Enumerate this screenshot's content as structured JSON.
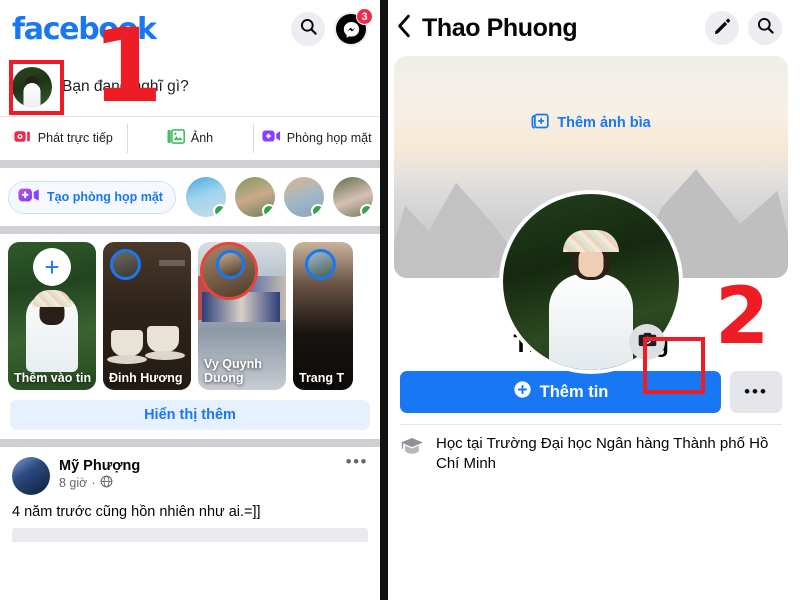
{
  "left_panel": {
    "brand": "facebook",
    "topbar": {
      "search_icon": "search-icon",
      "messenger_icon": "messenger-icon",
      "messenger_badge": "3"
    },
    "composer": {
      "placeholder": "Bạn đang nghĩ gì?",
      "avatar": "user-avatar"
    },
    "actions": [
      {
        "label": "Phát trực tiếp",
        "icon": "live-video-icon",
        "color": "#F02849"
      },
      {
        "label": "Ảnh",
        "icon": "photo-icon",
        "color": "#45BD62"
      },
      {
        "label": "Phòng họp mặt",
        "icon": "video-room-icon",
        "color": "#8A3FFC"
      }
    ],
    "rooms": {
      "create_room_label": "Tạo phòng họp mặt",
      "create_room_icon": "video-plus-icon",
      "online_friends": [
        {
          "name": "friend-1",
          "online": true
        },
        {
          "name": "friend-2",
          "online": true
        },
        {
          "name": "friend-3",
          "online": true
        },
        {
          "name": "friend-4",
          "online": true
        }
      ]
    },
    "stories": [
      {
        "label": "Thêm vào tin",
        "type": "add"
      },
      {
        "label": "Đinh Hương",
        "type": "story",
        "ring": "blue"
      },
      {
        "label": "Vy Quynh Duong",
        "type": "story",
        "ring": "red"
      },
      {
        "label": "Trang T",
        "type": "story",
        "ring": "blue"
      }
    ],
    "show_more_label": "Hiển thị thêm",
    "post": {
      "author": "Mỹ Phượng",
      "time": "8 giờ",
      "separator": "·",
      "audience_icon": "globe-icon",
      "menu_icon": "more-options-icon",
      "body": "4 năm trước cũng hồn nhiên như ai.=]]"
    }
  },
  "right_panel": {
    "header": {
      "back_icon": "back-chevron-icon",
      "title": "Thao Phuong",
      "edit_icon": "pencil-icon",
      "search_icon": "search-icon"
    },
    "cover": {
      "add_cover_label": "Thêm ảnh bìa",
      "add_cover_icon": "add-photo-icon"
    },
    "avatar": {
      "name": "profile-photo",
      "camera_icon": "camera-icon"
    },
    "profile_name": "Thao Phuong",
    "actions": {
      "primary_label": "Thêm tin",
      "primary_icon": "plus-circle-icon",
      "more_icon": "more-options-icon"
    },
    "details": [
      {
        "icon": "graduation-cap-icon",
        "text": "Học tại Trường Đại học Ngân hàng Thành phố Hồ Chí Minh"
      }
    ]
  },
  "annotations": [
    {
      "label": "1",
      "color": "#EE1C25",
      "target": "composer-avatar"
    },
    {
      "label": "2",
      "color": "#EE1C25",
      "target": "profile-camera-button"
    }
  ]
}
